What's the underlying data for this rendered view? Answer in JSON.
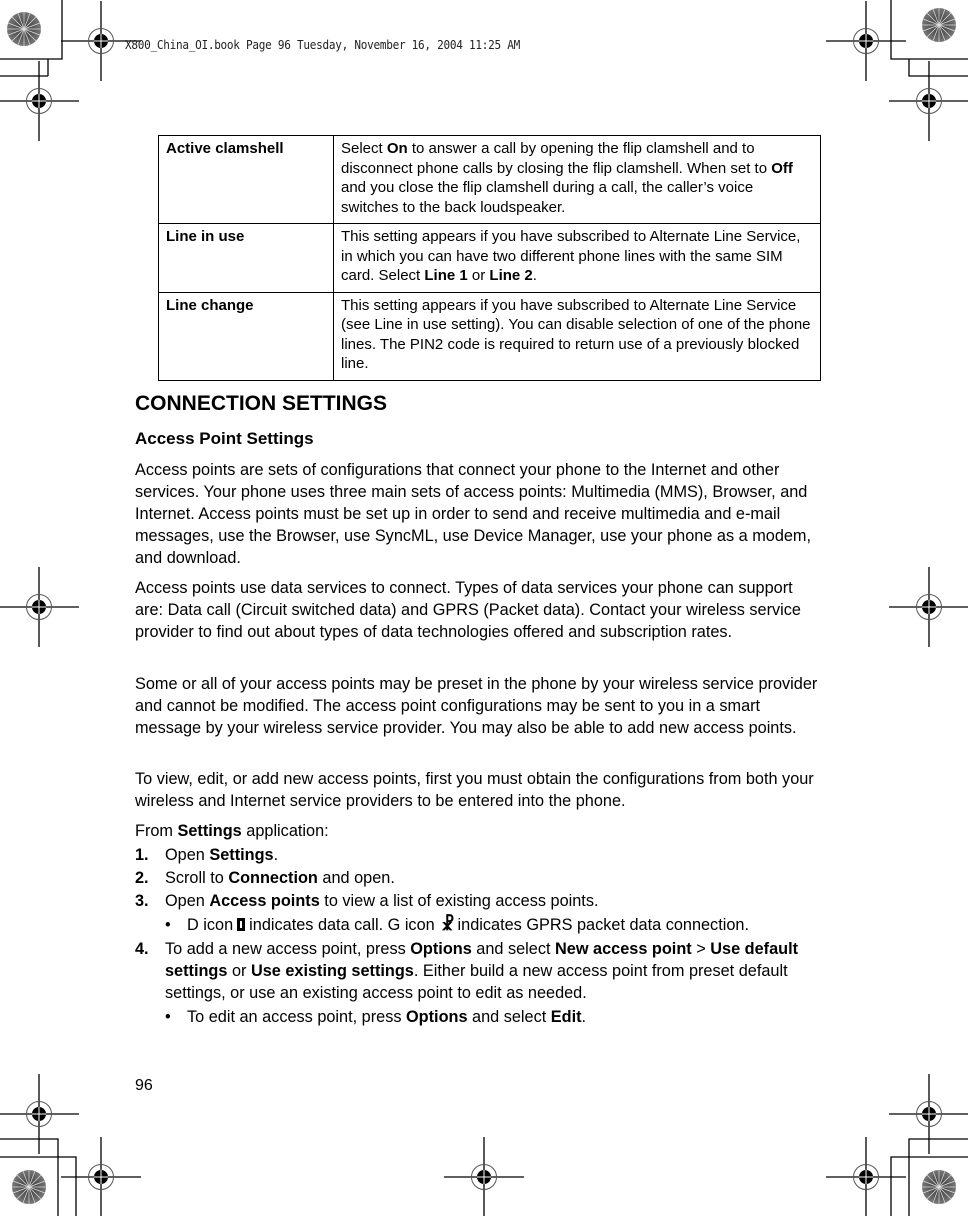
{
  "print_header": "X800_China_OI.book  Page 96  Tuesday, November 16, 2004  11:25 AM",
  "settings_table": [
    {
      "term": "Active clamshell",
      "parts": [
        {
          "t": "Select "
        },
        {
          "t": "On",
          "b": true
        },
        {
          "t": " to answer a call by opening the flip clamshell and to disconnect phone calls by closing the flip clamshell. When set to "
        },
        {
          "t": "Off",
          "b": true
        },
        {
          "t": " and you close the flip clamshell during a call, the caller’s voice switches to the back loudspeaker."
        }
      ]
    },
    {
      "term": "Line in use",
      "parts": [
        {
          "t": "This setting appears if you have subscribed to Alternate Line Service, in which you can have two different phone lines with the same SIM card. Select "
        },
        {
          "t": "Line 1",
          "b": true
        },
        {
          "t": " or "
        },
        {
          "t": "Line 2",
          "b": true
        },
        {
          "t": "."
        }
      ]
    },
    {
      "term": "Line change",
      "parts": [
        {
          "t": "This setting appears if you have subscribed to Alternate Line Service (see Line in use setting). You can disable selection of one of the phone lines. The PIN2 code is required to return use of a previously blocked line."
        }
      ]
    }
  ],
  "section_title": "CONNECTION SETTINGS",
  "subsection_title": "Access Point Settings",
  "paragraphs": [
    "Access points are sets of configurations that connect your phone to the Internet and other services. Your phone uses three main sets of access points: Multimedia (MMS), Browser, and Internet. Access points must be set up in order to send and receive multimedia and e-mail messages, use the Browser, use SyncML, use Device Manager, use your phone as a modem, and download.",
    "Access points use data services to connect. Types of data services your phone can support are: Data call (Circuit switched data) and GPRS (Packet data). Contact your wireless service provider to find out about types of data technologies offered and subscription rates.",
    "Some or all of your access points may be preset in the phone by your wireless service provider and cannot be modified. The access point configurations may be sent to you in a smart message by your wireless service provider. You may also be able to add new access points.",
    "To view, edit, or add new access points, first you must obtain the configurations from both your wireless and Internet service providers to be entered into the phone."
  ],
  "from_line": {
    "pre": "From ",
    "bold": "Settings",
    "post": " application:"
  },
  "steps": [
    {
      "num": "1.",
      "parts": [
        {
          "t": "Open "
        },
        {
          "t": "Settings",
          "b": true
        },
        {
          "t": "."
        }
      ]
    },
    {
      "num": "2.",
      "parts": [
        {
          "t": "Scroll to "
        },
        {
          "t": "Connection",
          "b": true
        },
        {
          "t": " and open."
        }
      ]
    },
    {
      "num": "3.",
      "parts": [
        {
          "t": "Open "
        },
        {
          "t": "Access points",
          "b": true
        },
        {
          "t": " to view a list of existing access points."
        }
      ]
    },
    {
      "num": "4.",
      "parts": [
        {
          "t": "To add a new access point, press "
        },
        {
          "t": "Options",
          "b": true
        },
        {
          "t": " and select "
        },
        {
          "t": "New access point",
          "b": true
        },
        {
          "t": " > "
        },
        {
          "t": "Use default settings",
          "b": true
        },
        {
          "t": " or "
        },
        {
          "t": "Use existing settings",
          "b": true
        },
        {
          "t": ". Either build a new access point from preset default settings, or use an existing access point to edit as needed."
        }
      ]
    }
  ],
  "bullet_icons": {
    "bullet": "•",
    "d_pre": "D icon",
    "d_post": "indicates data call. G icon",
    "g_glyph": "☧",
    "g_post": "indicates GPRS packet data connection."
  },
  "bullet_edit": [
    {
      "t": "To edit an access point, press "
    },
    {
      "t": "Options",
      "b": true
    },
    {
      "t": " and select "
    },
    {
      "t": "Edit",
      "b": true
    },
    {
      "t": "."
    }
  ],
  "page_number": "96"
}
